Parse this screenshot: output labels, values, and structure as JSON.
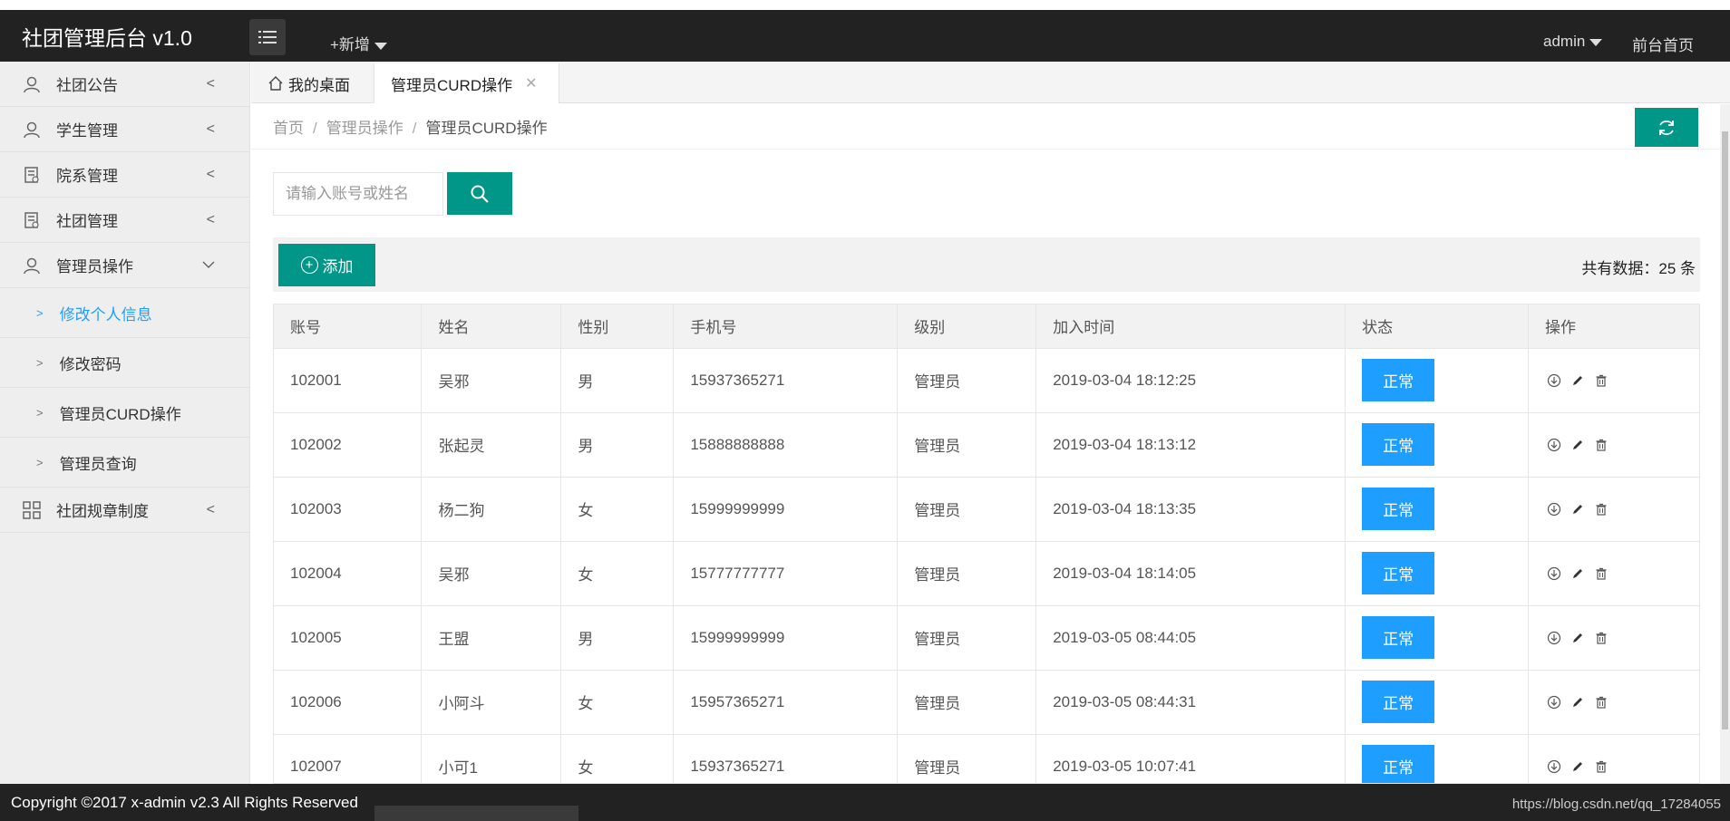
{
  "header": {
    "title": "社团管理后台 v1.0",
    "add_new": "+新增",
    "user": "admin",
    "front_home": "前台首页"
  },
  "sidebar": {
    "items": [
      {
        "label": "社团公告",
        "icon": "user-icon"
      },
      {
        "label": "学生管理",
        "icon": "user-icon"
      },
      {
        "label": "院系管理",
        "icon": "document-icon"
      },
      {
        "label": "社团管理",
        "icon": "document-icon"
      },
      {
        "label": "管理员操作",
        "icon": "user-icon"
      },
      {
        "label": "社团规章制度",
        "icon": "grid-icon"
      }
    ],
    "sub_items": [
      {
        "label": "修改个人信息"
      },
      {
        "label": "修改密码"
      },
      {
        "label": "管理员CURD操作"
      },
      {
        "label": "管理员查询"
      }
    ]
  },
  "tabs": {
    "home": "我的桌面",
    "active": "管理员CURD操作"
  },
  "breadcrumb": {
    "home": "首页",
    "section": "管理员操作",
    "current": "管理员CURD操作"
  },
  "search": {
    "placeholder": "请输入账号或姓名"
  },
  "toolbar": {
    "add_label": "添加",
    "count_text": "共有数据：25 条"
  },
  "table": {
    "headers": [
      "账号",
      "姓名",
      "性别",
      "手机号",
      "级别",
      "加入时间",
      "状态",
      "操作"
    ],
    "rows": [
      {
        "account": "102001",
        "name": "吴邪",
        "gender": "男",
        "phone": "15937365271",
        "level": "管理员",
        "joined": "2019-03-04 18:12:25",
        "status": "正常"
      },
      {
        "account": "102002",
        "name": "张起灵",
        "gender": "男",
        "phone": "15888888888",
        "level": "管理员",
        "joined": "2019-03-04 18:13:12",
        "status": "正常"
      },
      {
        "account": "102003",
        "name": "杨二狗",
        "gender": "女",
        "phone": "15999999999",
        "level": "管理员",
        "joined": "2019-03-04 18:13:35",
        "status": "正常"
      },
      {
        "account": "102004",
        "name": "吴邪",
        "gender": "女",
        "phone": "15777777777",
        "level": "管理员",
        "joined": "2019-03-04 18:14:05",
        "status": "正常"
      },
      {
        "account": "102005",
        "name": "王盟",
        "gender": "男",
        "phone": "15999999999",
        "level": "管理员",
        "joined": "2019-03-05 08:44:05",
        "status": "正常"
      },
      {
        "account": "102006",
        "name": "小阿斗",
        "gender": "女",
        "phone": "15957365271",
        "level": "管理员",
        "joined": "2019-03-05 08:44:31",
        "status": "正常"
      },
      {
        "account": "102007",
        "name": "小可1",
        "gender": "女",
        "phone": "15937365271",
        "level": "管理员",
        "joined": "2019-03-05 10:07:41",
        "status": "正常"
      }
    ]
  },
  "footer": {
    "copyright": "Copyright ©2017 x-admin v2.3 All Rights Reserved",
    "watermark": "https://blog.csdn.net/qq_17284055"
  },
  "colors": {
    "header_bg": "#222222",
    "accent": "#009688",
    "status_blue": "#1e9fff",
    "sidebar_bg": "#eeeeee"
  }
}
